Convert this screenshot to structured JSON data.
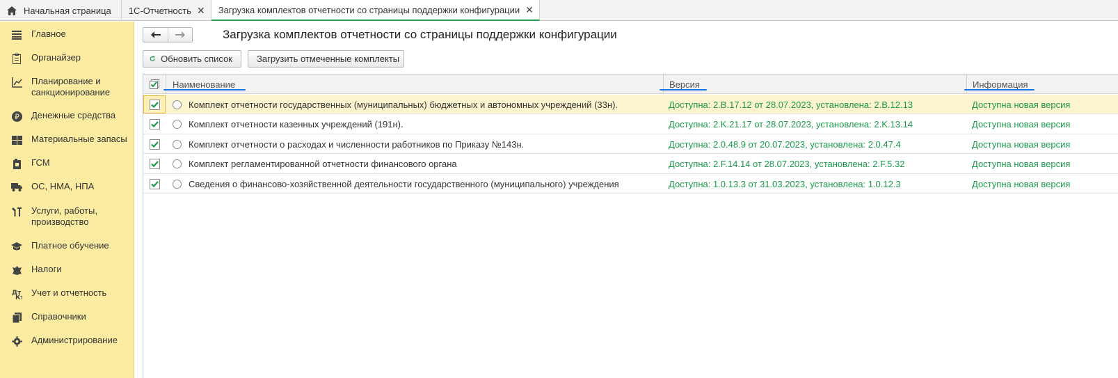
{
  "tabs": [
    {
      "label": "Начальная страница",
      "icon": "home-icon"
    },
    {
      "label": "1С-Отчетность",
      "closable": true
    },
    {
      "label": "Загрузка комплектов отчетности со страницы поддержки конфигурации",
      "closable": true,
      "active": true
    }
  ],
  "sidebar": {
    "items": [
      {
        "label": "Главное",
        "icon": "menu-icon"
      },
      {
        "label": "Органайзер",
        "icon": "organizer-icon"
      },
      {
        "label": "Планирование и санкционирование",
        "icon": "planning-icon"
      },
      {
        "label": "Денежные средства",
        "icon": "ruble-icon"
      },
      {
        "label": "Материальные запасы",
        "icon": "stock-icon"
      },
      {
        "label": "ГСМ",
        "icon": "fuel-icon"
      },
      {
        "label": "ОС, НМА, НПА",
        "icon": "truck-icon"
      },
      {
        "label": "Услуги, работы, производство",
        "icon": "tools-icon"
      },
      {
        "label": "Платное обучение",
        "icon": "graduation-icon"
      },
      {
        "label": "Налоги",
        "icon": "emblem-icon"
      },
      {
        "label": "Учет и отчетность",
        "icon": "accounting-icon"
      },
      {
        "label": "Справочники",
        "icon": "reference-icon"
      },
      {
        "label": "Администрирование",
        "icon": "gear-icon"
      }
    ]
  },
  "page": {
    "title": "Загрузка комплектов отчетности со страницы поддержки конфигурации",
    "refresh_label": "Обновить список",
    "load_label": "Загрузить отмеченные комплекты"
  },
  "table": {
    "columns": [
      "Наименование",
      "Версия",
      "Информация"
    ],
    "rows": [
      {
        "checked": true,
        "selected": true,
        "name": "Комплект отчетности государственных (муниципальных) бюджетных и автономных учреждений (33н).",
        "version": "Доступна: 2.B.17.12 от 28.07.2023, установлена: 2.B.12.13",
        "info": "Доступна новая версия"
      },
      {
        "checked": true,
        "name": "Комплект отчетности казенных учреждений (191н).",
        "version": "Доступна: 2.K.21.17 от 28.07.2023, установлена: 2.K.13.14",
        "info": "Доступна новая версия"
      },
      {
        "checked": true,
        "name": "Комплект отчетности о расходах и численности работников по Приказу №143н.",
        "version": "Доступна: 2.0.48.9 от 20.07.2023, установлена: 2.0.47.4",
        "info": "Доступна новая версия"
      },
      {
        "checked": true,
        "name": "Комплект регламентированной отчетности финансового органа",
        "version": "Доступна: 2.F.14.14 от 28.07.2023, установлена: 2.F.5.32",
        "info": "Доступна новая версия"
      },
      {
        "checked": true,
        "name": "Сведения о финансово-хозяйственной деятельности государственного (муниципального) учреждения",
        "version": "Доступна: 1.0.13.3 от 31.03.2023, установлена: 1.0.12.3",
        "info": "Доступна новая версия"
      }
    ]
  },
  "colors": {
    "sidebar_bg": "#fbeca2",
    "accent_green": "#1a9b4a",
    "header_underline": "#1a73e8",
    "selected_row": "#fcf3cf"
  }
}
